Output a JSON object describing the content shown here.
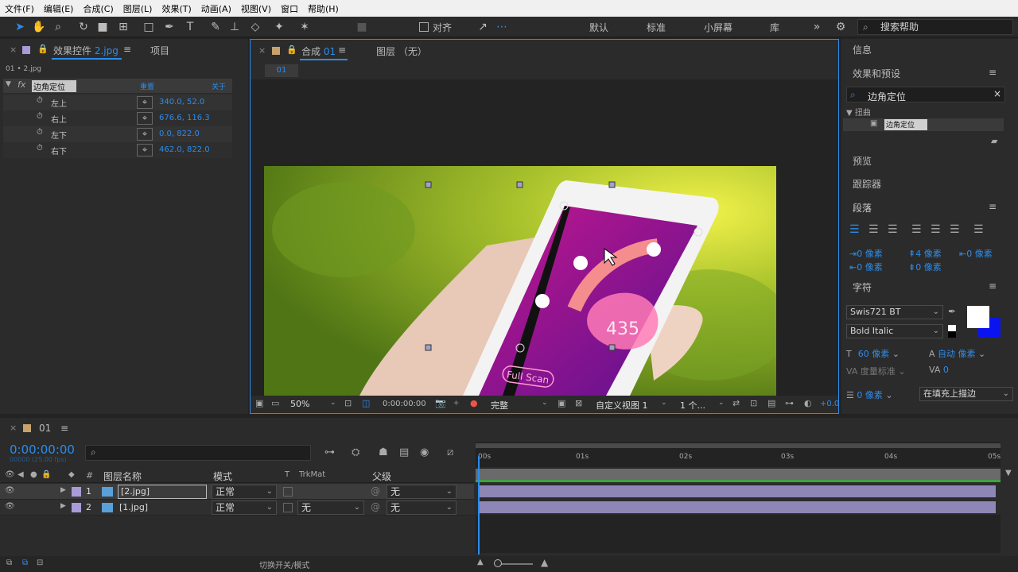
{
  "menu": [
    "文件(F)",
    "编辑(E)",
    "合成(C)",
    "图层(L)",
    "效果(T)",
    "动画(A)",
    "视图(V)",
    "窗口",
    "帮助(H)"
  ],
  "toolbar": {
    "snap_label": "对齐",
    "workspaces": [
      "默认",
      "标准",
      "小屏幕",
      "库"
    ],
    "search_placeholder": "搜索帮助"
  },
  "effect_panel": {
    "tab_label": "效果控件",
    "tab_file": "2.jpg",
    "project_tab": "项目",
    "breadcrumb": "01 • 2.jpg",
    "fx_label": "fx",
    "effect_name": "边角定位",
    "reset": "重置",
    "about": "关于",
    "params": [
      {
        "name": "左上",
        "value": "340.0, 52.0"
      },
      {
        "name": "右上",
        "value": "676.6, 116.3"
      },
      {
        "name": "左下",
        "value": "0.0, 822.0"
      },
      {
        "name": "右下",
        "value": "462.0, 822.0"
      }
    ]
  },
  "comp_panel": {
    "tab_label": "合成",
    "tab_num": "01",
    "layer_tab": "图层 （无）",
    "sub_tab": "01",
    "zoom": "50%",
    "timecode": "0:00:00:00",
    "resolution": "完整",
    "view": "自定义视图 1",
    "views_count": "1 个...",
    "exposure": "+0.0"
  },
  "phone_screen": {
    "number": "435",
    "button": "Full Scan"
  },
  "right_panel": {
    "info": "信息",
    "effects_presets": "效果和预设",
    "search_value": "边角定位",
    "category": "扭曲",
    "result": "边角定位",
    "preview": "预览",
    "tracker": "跟踪器",
    "paragraph": "段落",
    "indent_values": [
      "0 像素",
      "4 像素",
      "0 像素",
      "0 像素",
      "0 像素"
    ],
    "character": "字符",
    "font": "Swis721 BT",
    "style": "Bold Italic",
    "size": "60 像素",
    "leading": "自动 像素",
    "kerning": "度量标准",
    "tracking": "0",
    "stroke_width": "0 像素",
    "stroke_mode": "在填充上描边"
  },
  "timeline": {
    "tab": "01",
    "timecode": "0:00:00:00",
    "fps": "00000 (25.00 fps)",
    "search_placeholder": "",
    "col_hash": "#",
    "col_name": "图层名称",
    "col_mode": "模式",
    "col_t": "T",
    "col_trkmat": "TrkMat",
    "col_parent": "父级",
    "layers": [
      {
        "num": "1",
        "name": "[2.jpg]",
        "mode": "正常",
        "trkmat": "",
        "parent": "无"
      },
      {
        "num": "2",
        "name": "[1.jpg]",
        "mode": "正常",
        "trkmat": "无",
        "parent": "无"
      }
    ],
    "ruler": [
      "00s",
      "01s",
      "02s",
      "03s",
      "04s",
      "05s"
    ],
    "footer_toggle": "切换开关/模式"
  },
  "colors": {
    "accent": "#2d8ceb",
    "layer_label": "#a99bd7",
    "layer_bar": "#8e86b5"
  }
}
